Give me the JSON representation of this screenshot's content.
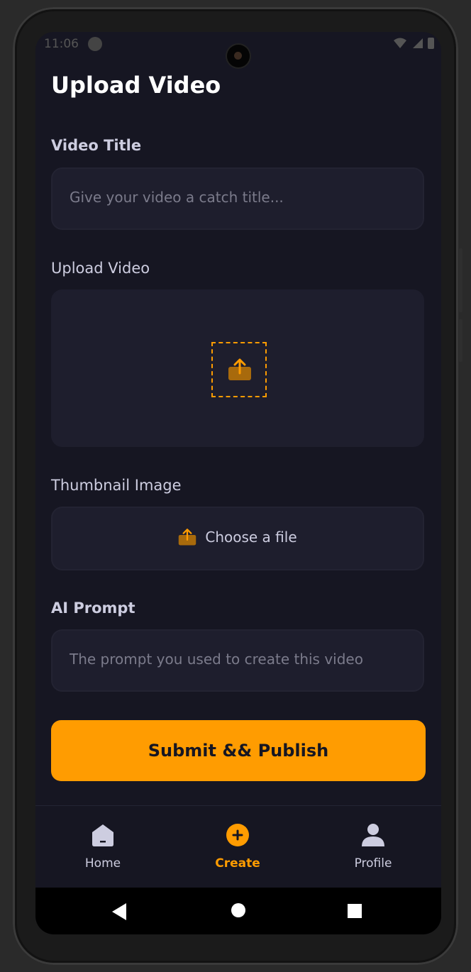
{
  "status_bar": {
    "time": "11:06"
  },
  "page": {
    "title": "Upload Video"
  },
  "form": {
    "video_title": {
      "label": "Video Title",
      "placeholder": "Give your video a catch title..."
    },
    "upload_video": {
      "label": "Upload Video",
      "icon": "upload-icon"
    },
    "thumbnail": {
      "label": "Thumbnail Image",
      "button_label": "Choose a file",
      "icon": "upload-icon"
    },
    "ai_prompt": {
      "label": "AI Prompt",
      "placeholder": "The prompt you used to create this video"
    },
    "submit_label": "Submit && Publish"
  },
  "tabs": [
    {
      "label": "Home",
      "icon": "home-icon",
      "active": false
    },
    {
      "label": "Create",
      "icon": "plus-circle-icon",
      "active": true
    },
    {
      "label": "Profile",
      "icon": "profile-icon",
      "active": false
    }
  ],
  "colors": {
    "background": "#161622",
    "field_background": "#1e1e2d",
    "accent": "#ff9c01",
    "text": "#ffffff",
    "muted_text": "#cdcde0"
  }
}
